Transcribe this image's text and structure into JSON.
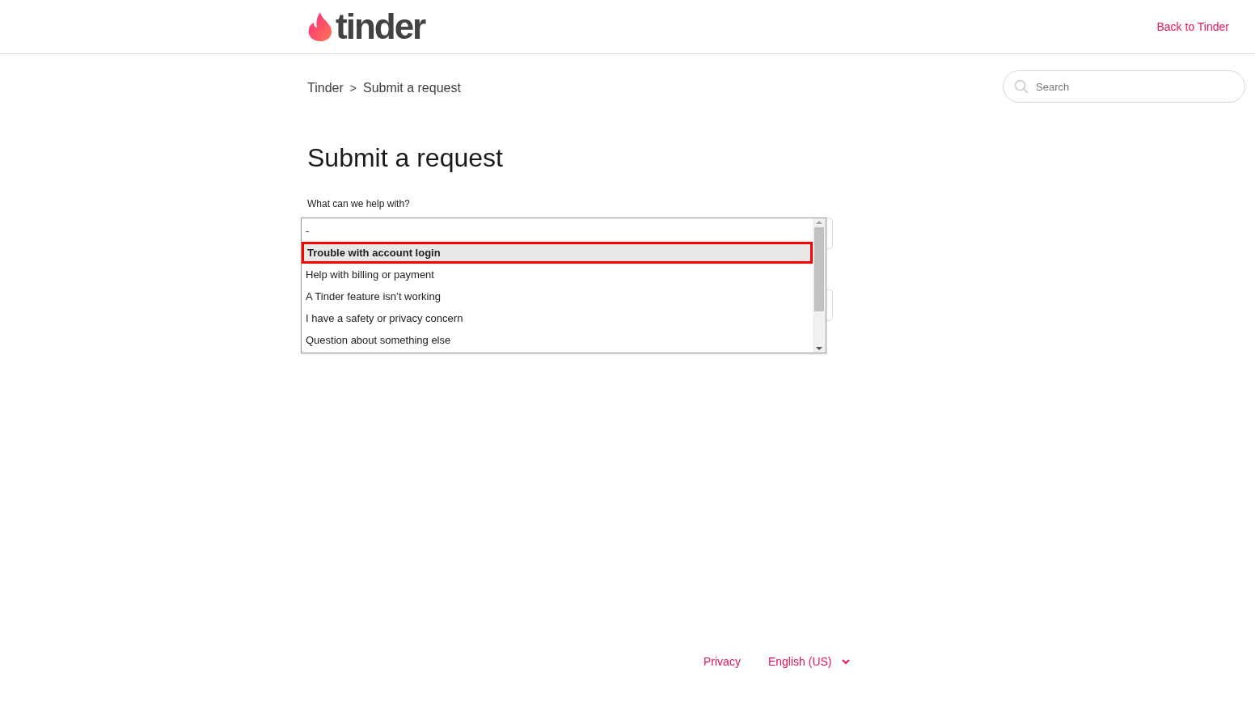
{
  "header": {
    "logo_text": "tinder",
    "back_link": "Back to Tinder"
  },
  "breadcrumb": {
    "items": [
      "Tinder",
      "Submit a request"
    ],
    "separator": ">"
  },
  "search": {
    "placeholder": "Search"
  },
  "page_title": "Submit a request",
  "form": {
    "label": "What can we help with?",
    "dropdown": {
      "options": [
        {
          "label": "-",
          "selected": false
        },
        {
          "label": "Trouble with account login",
          "selected": true
        },
        {
          "label": "Help with billing or payment",
          "selected": false
        },
        {
          "label": "A Tinder feature isn’t working",
          "selected": false
        },
        {
          "label": "I have a safety or privacy concern",
          "selected": false
        },
        {
          "label": "Question about something else",
          "selected": false
        }
      ]
    }
  },
  "footer": {
    "links": [
      "Privacy"
    ],
    "language": "English (US)"
  }
}
